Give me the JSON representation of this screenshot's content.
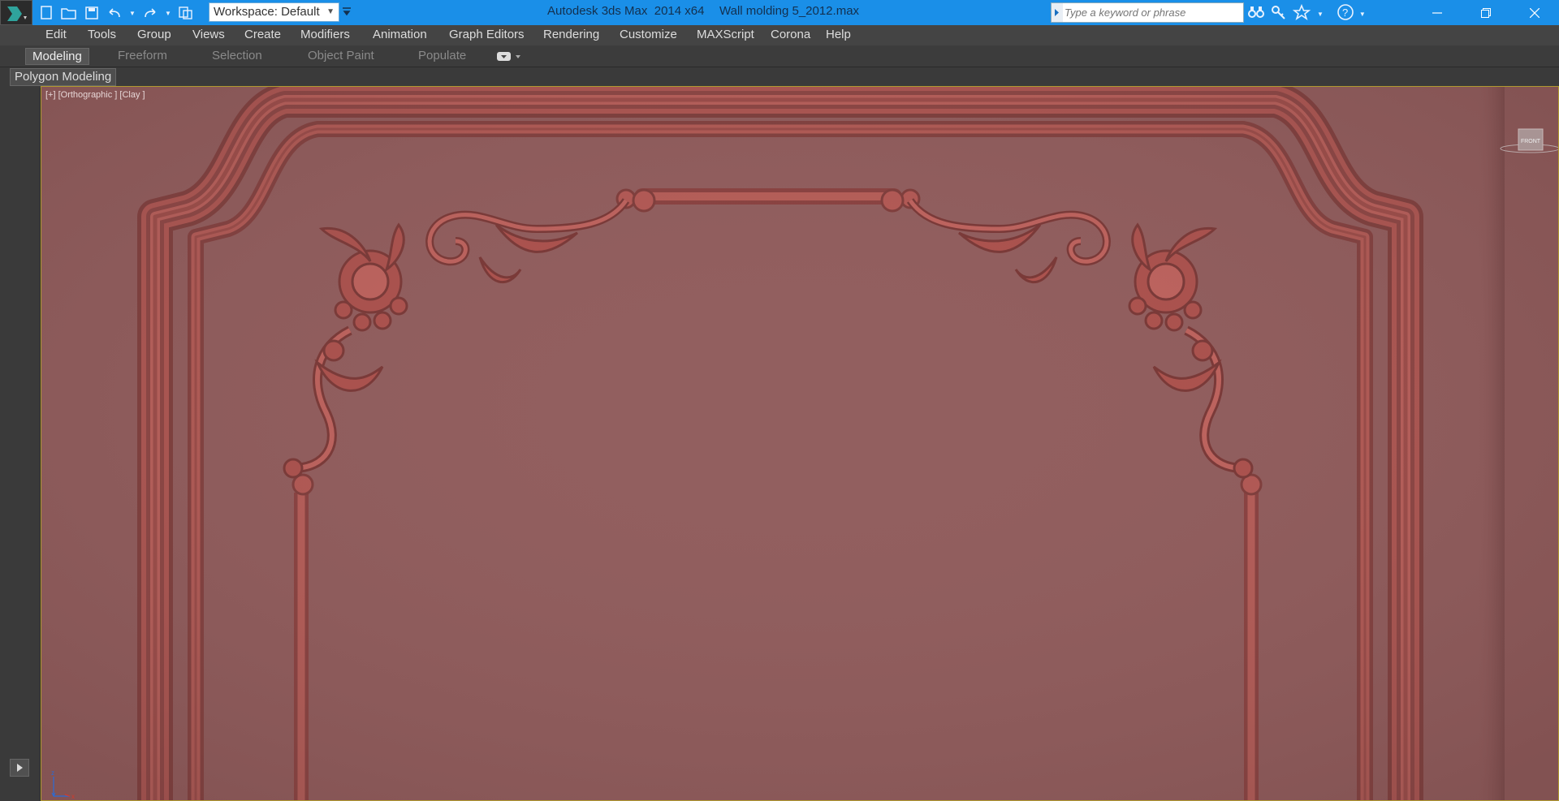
{
  "titlebar": {
    "app_name": "Autodesk 3ds Max  2014 x64",
    "file_name": "Wall molding 5_2012.max",
    "workspace": "Workspace: Default",
    "search_placeholder": "Type a keyword or phrase",
    "accent": "#1a8fe8"
  },
  "menu": [
    "Edit",
    "Tools",
    "Group",
    "Views",
    "Create",
    "Modifiers",
    "Animation",
    "Graph Editors",
    "Rendering",
    "Customize",
    "MAXScript",
    "Corona",
    "Help"
  ],
  "ribbon": {
    "tabs": [
      "Modeling",
      "Freeform",
      "Selection",
      "Object Paint",
      "Populate"
    ],
    "active_tab": "Modeling",
    "panel_label": "Polygon Modeling"
  },
  "viewport": {
    "label": "[+] [Orthographic ] [Clay ]",
    "viewcube_label": "FRONT",
    "background": "#925f5f",
    "molding_color": "#a84d4a"
  }
}
